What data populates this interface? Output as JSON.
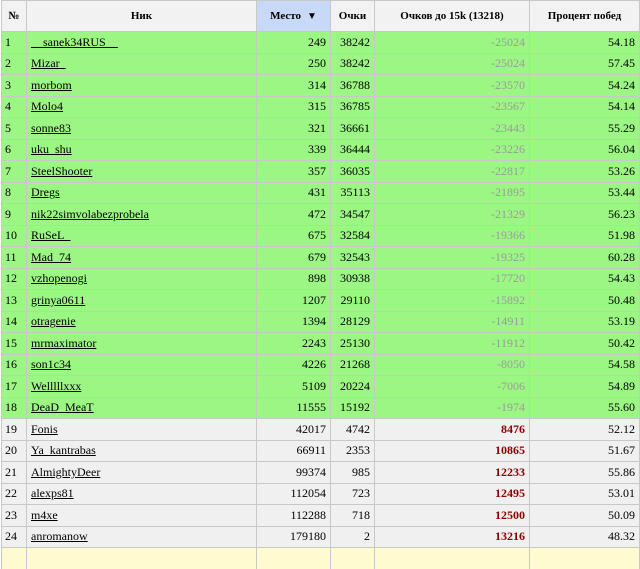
{
  "colors": {
    "green_row": "#9cf684",
    "grey_row": "#f0f0f0",
    "header_bg": "#f2f2f2",
    "sorted_header_bg": "#c7d9f7",
    "positive_diff": "#8b0000",
    "negative_diff": "#9b9b9b"
  },
  "headers": {
    "num": "№",
    "nick": "Ник",
    "place": "Место",
    "points": "Очки",
    "to15k": "Очков до 15k (13218)",
    "winrate": "Процент побед"
  },
  "sort_icon": "triangle-down-icon",
  "rows": [
    {
      "n": "1",
      "nick": "__sanek34RUS__",
      "place": "249",
      "points": "38242",
      "diff": "-25024",
      "win": "54.18",
      "green": true
    },
    {
      "n": "2",
      "nick": "Mizar_",
      "place": "250",
      "points": "38242",
      "diff": "-25024",
      "win": "57.45",
      "green": true
    },
    {
      "n": "3",
      "nick": "morbom",
      "place": "314",
      "points": "36788",
      "diff": "-23570",
      "win": "54.24",
      "green": true
    },
    {
      "n": "4",
      "nick": "Molo4",
      "place": "315",
      "points": "36785",
      "diff": "-23567",
      "win": "54.14",
      "green": true
    },
    {
      "n": "5",
      "nick": "sonne83",
      "place": "321",
      "points": "36661",
      "diff": "-23443",
      "win": "55.29",
      "green": true
    },
    {
      "n": "6",
      "nick": "uku_shu",
      "place": "339",
      "points": "36444",
      "diff": "-23226",
      "win": "56.04",
      "green": true
    },
    {
      "n": "7",
      "nick": "SteelShooter",
      "place": "357",
      "points": "36035",
      "diff": "-22817",
      "win": "53.26",
      "green": true
    },
    {
      "n": "8",
      "nick": "Dregs",
      "place": "431",
      "points": "35113",
      "diff": "-21895",
      "win": "53.44",
      "green": true
    },
    {
      "n": "9",
      "nick": "nik22simvolabezprobela",
      "place": "472",
      "points": "34547",
      "diff": "-21329",
      "win": "56.23",
      "green": true
    },
    {
      "n": "10",
      "nick": "RuSeL_",
      "place": "675",
      "points": "32584",
      "diff": "-19366",
      "win": "51.98",
      "green": true
    },
    {
      "n": "11",
      "nick": "Mad_74",
      "place": "679",
      "points": "32543",
      "diff": "-19325",
      "win": "60.28",
      "green": true
    },
    {
      "n": "12",
      "nick": "vzhopenogi",
      "place": "898",
      "points": "30938",
      "diff": "-17720",
      "win": "54.43",
      "green": true
    },
    {
      "n": "13",
      "nick": "grinya0611",
      "place": "1207",
      "points": "29110",
      "diff": "-15892",
      "win": "50.48",
      "green": true
    },
    {
      "n": "14",
      "nick": "otragenie",
      "place": "1394",
      "points": "28129",
      "diff": "-14911",
      "win": "53.19",
      "green": true
    },
    {
      "n": "15",
      "nick": "mrmaximator",
      "place": "2243",
      "points": "25130",
      "diff": "-11912",
      "win": "50.42",
      "green": true
    },
    {
      "n": "16",
      "nick": "son1c34",
      "place": "4226",
      "points": "21268",
      "diff": "-8050",
      "win": "54.58",
      "green": true
    },
    {
      "n": "17",
      "nick": "Welllllxxx",
      "place": "5109",
      "points": "20224",
      "diff": "-7006",
      "win": "54.89",
      "green": true
    },
    {
      "n": "18",
      "nick": "DeaD_MeaT",
      "place": "11555",
      "points": "15192",
      "diff": "-1974",
      "win": "55.60",
      "green": true
    },
    {
      "n": "19",
      "nick": "Fonis",
      "place": "42017",
      "points": "4742",
      "diff": "8476",
      "win": "52.12",
      "green": false
    },
    {
      "n": "20",
      "nick": "Ya_kantrabas",
      "place": "66911",
      "points": "2353",
      "diff": "10865",
      "win": "51.67",
      "green": false
    },
    {
      "n": "21",
      "nick": "AlmightyDeer",
      "place": "99374",
      "points": "985",
      "diff": "12233",
      "win": "55.86",
      "green": false
    },
    {
      "n": "22",
      "nick": "alexps81",
      "place": "112054",
      "points": "723",
      "diff": "12495",
      "win": "53.01",
      "green": false
    },
    {
      "n": "23",
      "nick": "m4xe",
      "place": "112288",
      "points": "718",
      "diff": "12500",
      "win": "50.09",
      "green": false
    },
    {
      "n": "24",
      "nick": "anromanow",
      "place": "179180",
      "points": "2",
      "diff": "13216",
      "win": "48.32",
      "green": false
    }
  ]
}
